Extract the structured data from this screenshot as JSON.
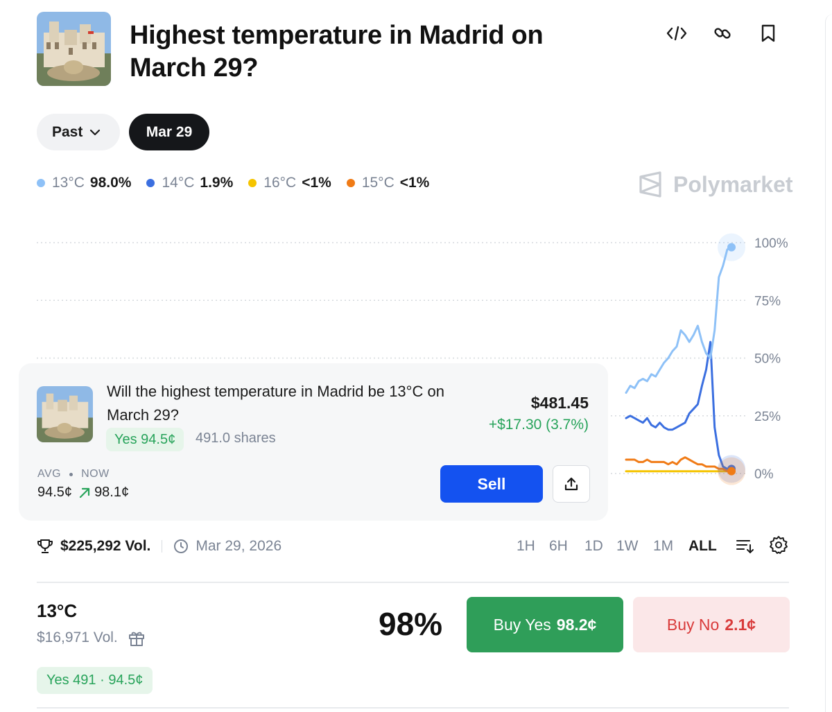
{
  "header": {
    "title": "Highest temperature in Madrid on March 29?"
  },
  "filters": {
    "past_label": "Past",
    "date_label": "Mar 29"
  },
  "legend": [
    {
      "name": "13°C",
      "value": "98.0%",
      "color": "#8ec1f7"
    },
    {
      "name": "14°C",
      "value": "1.9%",
      "color": "#3b6fe0"
    },
    {
      "name": "16°C",
      "value": "<1%",
      "color": "#f5c400"
    },
    {
      "name": "15°C",
      "value": "<1%",
      "color": "#f07b16"
    }
  ],
  "brand": "Polymarket",
  "chart_data": {
    "type": "line",
    "y_ticks": [
      "100%",
      "75%",
      "50%",
      "25%",
      "0%"
    ],
    "ylim": [
      0,
      100
    ],
    "grid": true,
    "series": [
      {
        "name": "13°C",
        "color": "#8ec1f7",
        "values": [
          35,
          38,
          37,
          40,
          41,
          40,
          43,
          42,
          45,
          48,
          50,
          53,
          55,
          62,
          60,
          57,
          60,
          64,
          57,
          52,
          50,
          62,
          85,
          90,
          97,
          98
        ]
      },
      {
        "name": "14°C",
        "color": "#3b6fe0",
        "values": [
          24,
          25,
          24,
          23,
          22,
          24,
          21,
          20,
          22,
          20,
          19,
          19,
          20,
          21,
          22,
          26,
          28,
          30,
          38,
          45,
          57,
          20,
          8,
          3,
          2,
          2
        ]
      },
      {
        "name": "16°C",
        "color": "#f5c400",
        "values": [
          1,
          1,
          1,
          1,
          1,
          1,
          1,
          1,
          1,
          1,
          1,
          1,
          1,
          1,
          1,
          1,
          1,
          1,
          1,
          1,
          1,
          1,
          1,
          1,
          1,
          1
        ]
      },
      {
        "name": "15°C",
        "color": "#f07b16",
        "values": [
          6,
          6,
          6,
          5,
          5,
          6,
          5,
          5,
          5,
          5,
          4,
          5,
          4,
          6,
          7,
          6,
          5,
          4,
          4,
          3,
          3,
          3,
          2,
          2,
          1,
          1
        ]
      }
    ]
  },
  "position": {
    "question": "Will the highest temperature in Madrid be 13°C on March 29?",
    "side_price": "Yes 94.5¢",
    "shares": "491.0 shares",
    "value": "$481.45",
    "pnl": "+$17.30 (3.7%)",
    "avg_label": "AVG",
    "now_label": "NOW",
    "avg_price": "94.5¢",
    "now_price": "98.1¢",
    "sell_label": "Sell"
  },
  "stats": {
    "volume": "$225,292 Vol.",
    "end_date": "Mar 29, 2026"
  },
  "ranges": [
    "1H",
    "6H",
    "1D",
    "1W",
    "1M",
    "ALL"
  ],
  "outcome": {
    "name": "13°C",
    "volume": "$16,971 Vol.",
    "percent": "98%",
    "buy_yes_label": "Buy Yes",
    "buy_yes_price": "98.2¢",
    "buy_no_label": "Buy No",
    "buy_no_price": "2.1¢",
    "holding": "Yes 491 · 94.5¢"
  }
}
